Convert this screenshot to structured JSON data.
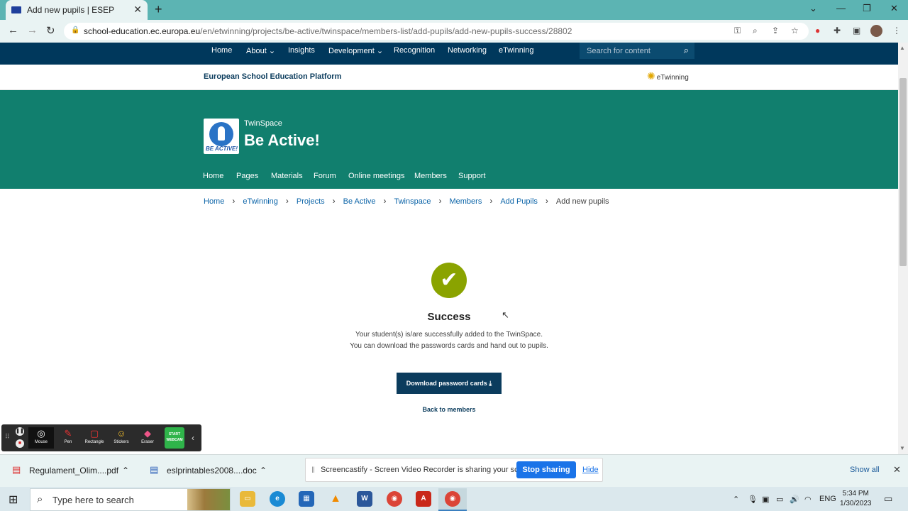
{
  "browser": {
    "tab_title": "Add new pupils | ESEP",
    "url_host": "school-education.ec.europa.eu",
    "url_path": "/en/etwinning/projects/be-active/twinspace/members-list/add-pupils/add-new-pupils-success/28802"
  },
  "topnav": {
    "items": [
      "Home",
      "About",
      "Insights",
      "Development",
      "Recognition",
      "Networking",
      "eTwinning"
    ],
    "search_placeholder": "Search for content"
  },
  "platform": {
    "name": "European School Education Platform",
    "etwinning_logo": "eTwinning"
  },
  "twinspace": {
    "label": "TwinSpace",
    "title": "Be Active!",
    "logo_text": "BE ACTIVE!",
    "subnav": [
      "Home",
      "Pages",
      "Materials",
      "Forum",
      "Online meetings",
      "Members",
      "Support"
    ]
  },
  "breadcrumb": {
    "items": [
      "Home",
      "eTwinning",
      "Projects",
      "Be Active",
      "Twinspace",
      "Members",
      "Add Pupils"
    ],
    "current": "Add new pupils"
  },
  "main": {
    "title": "Success",
    "line1": "Your student(s) is/are successfully added to the TwinSpace.",
    "line2": "You can download the passwords cards and hand out to pupils.",
    "download_label": "Download password cards",
    "back_label": "Back to members"
  },
  "screencastify_toolbar": {
    "tools": [
      "Mouse",
      "Pen",
      "Rectangle",
      "Stickers",
      "Eraser"
    ],
    "webcam_label": "START WEBCAM"
  },
  "downloads": {
    "items": [
      "Regulament_Olim....pdf",
      "eslprintables2008....doc"
    ],
    "share_text": "Screencastify - Screen Video Recorder is sharing your screen.",
    "stop_label": "Stop sharing",
    "hide_label": "Hide",
    "show_all_label": "Show all"
  },
  "taskbar": {
    "search_placeholder": "Type here to search",
    "language": "ENG",
    "time": "5:34 PM",
    "date": "1/30/2023"
  },
  "colors": {
    "nav_dark": "#00385c",
    "banner_teal": "#117f6e",
    "success_green": "#8aa300",
    "button_blue": "#0b3c5d",
    "link_blue": "#0b64a8"
  }
}
